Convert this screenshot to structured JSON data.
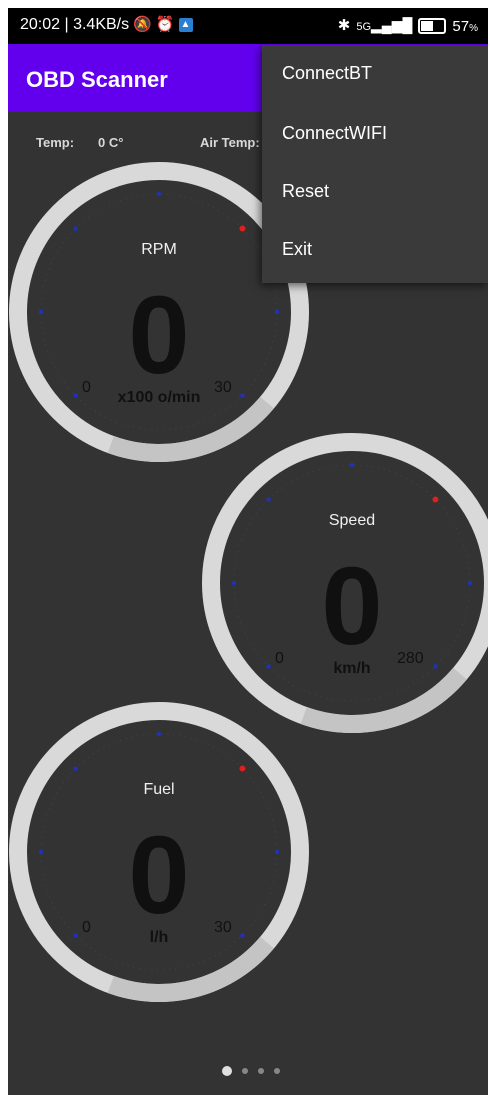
{
  "status_bar": {
    "time_info": "20:02 | 3.4KB/s",
    "icons": [
      "mute-notification-icon",
      "alarm-icon",
      "app-notification-icon",
      "bluetooth-icon",
      "5g-signal-icon",
      "battery-icon"
    ],
    "signal": "5G",
    "battery": "57",
    "battery_unit": "%"
  },
  "app_bar": {
    "title": "OBD Scanner"
  },
  "readouts": {
    "temp_label": "Temp:",
    "temp_value": "0 C°",
    "air_temp_label": "Air Temp:"
  },
  "gauges": [
    {
      "title": "RPM",
      "value": "0",
      "unit": "x100 o/min",
      "min": "0",
      "max": "30"
    },
    {
      "title": "Speed",
      "value": "0",
      "unit": "km/h",
      "min": "0",
      "max": "280"
    },
    {
      "title": "Fuel",
      "value": "0",
      "unit": "l/h",
      "min": "0",
      "max": "30"
    }
  ],
  "menu": {
    "items": [
      "ConnectBT",
      "ConnectWIFI",
      "Reset",
      "Exit"
    ]
  },
  "pager": {
    "pages": 4,
    "current": 1
  },
  "colors": {
    "background": "#333333",
    "app_bar": "#6200ee",
    "gauge_ring": "#d9d9d9",
    "tick_blue": "#2030c0",
    "tick_red": "#e02020",
    "value_text": "#101010"
  }
}
